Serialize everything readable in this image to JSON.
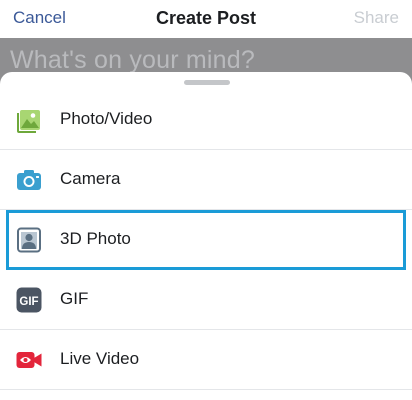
{
  "nav": {
    "cancel_label": "Cancel",
    "title": "Create Post",
    "share_label": "Share"
  },
  "composer": {
    "placeholder": "What's on your mind?"
  },
  "sheet": {
    "items": [
      {
        "label": "Photo/Video",
        "icon": "photo-video-icon",
        "color": "#78b63f"
      },
      {
        "label": "Camera",
        "icon": "camera-icon",
        "color": "#3a9fcf"
      },
      {
        "label": "3D Photo",
        "icon": "3d-photo-icon",
        "color": "#5a6f82",
        "selected": true
      },
      {
        "label": "GIF",
        "icon": "gif-icon",
        "color": "#4b5563"
      },
      {
        "label": "Live Video",
        "icon": "live-video-icon",
        "color": "#e3253b"
      }
    ]
  },
  "colors": {
    "accent": "#3b5998",
    "selection_border": "#1a9bd7",
    "share_disabled": "#c9cdd2"
  }
}
